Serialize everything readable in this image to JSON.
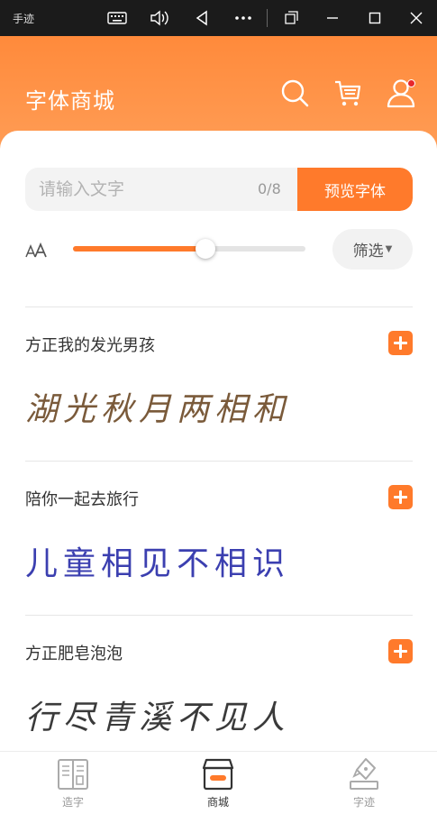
{
  "window_bar": {
    "title": "手迹"
  },
  "header": {
    "title": "字体商城",
    "icons": [
      "search-icon",
      "cart-icon",
      "user-icon"
    ]
  },
  "search": {
    "placeholder": "请输入文字",
    "value": "",
    "counter": "0/8",
    "preview_button": "预览字体"
  },
  "size_control": {
    "icon": "font-size-icon",
    "slider_level_percent": 57,
    "filter_label": "筛选"
  },
  "fonts": [
    {
      "name": "方正我的发光男孩",
      "sample": "湖光秋月两相和"
    },
    {
      "name": "陪你一起去旅行",
      "sample": "儿童相见不相识"
    },
    {
      "name": "方正肥皂泡泡",
      "sample": "行尽青溪不见人"
    }
  ],
  "bottom_nav": {
    "items": [
      {
        "label": "造字",
        "icon": "book-icon",
        "active": false
      },
      {
        "label": "商城",
        "icon": "shop-icon",
        "active": true
      },
      {
        "label": "字迹",
        "icon": "pen-icon",
        "active": false
      }
    ]
  },
  "colors": {
    "accent": "#ff7a2b",
    "header_gradient_top": "#ff8a3b",
    "header_gradient_bottom": "#ffa05a",
    "notification_dot": "#e8272b"
  }
}
